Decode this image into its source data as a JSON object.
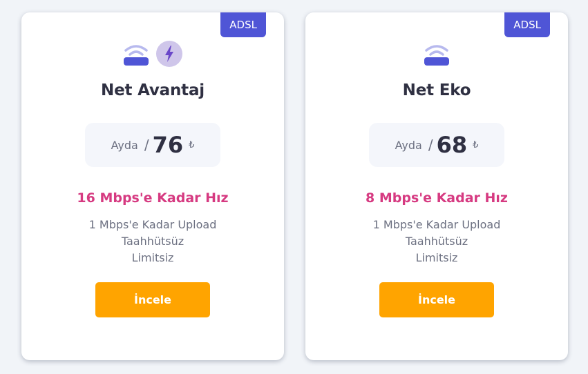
{
  "plans": [
    {
      "badge": "ADSL",
      "icons": [
        "wifi-router-icon",
        "lightning-bolt-icon"
      ],
      "name": "Net Avantaj",
      "period": "Ayda",
      "price": "76",
      "currency": "₺",
      "speed": "16 Mbps'e Kadar Hız",
      "features": [
        "1 Mbps'e Kadar Upload",
        "Taahhütsüz",
        "Limitsiz"
      ],
      "button_label": "İncele"
    },
    {
      "badge": "ADSL",
      "icons": [
        "wifi-router-icon"
      ],
      "name": "Net Eko",
      "period": "Ayda",
      "price": "68",
      "currency": "₺",
      "speed": "8 Mbps'e Kadar Hız",
      "features": [
        "1 Mbps'e Kadar Upload",
        "Taahhütsüz",
        "Limitsiz"
      ],
      "button_label": "İncele"
    }
  ],
  "colors": {
    "badge": "#4f55d6",
    "speed": "#d63a81",
    "button": "#ffa400",
    "title": "#2f3042"
  }
}
